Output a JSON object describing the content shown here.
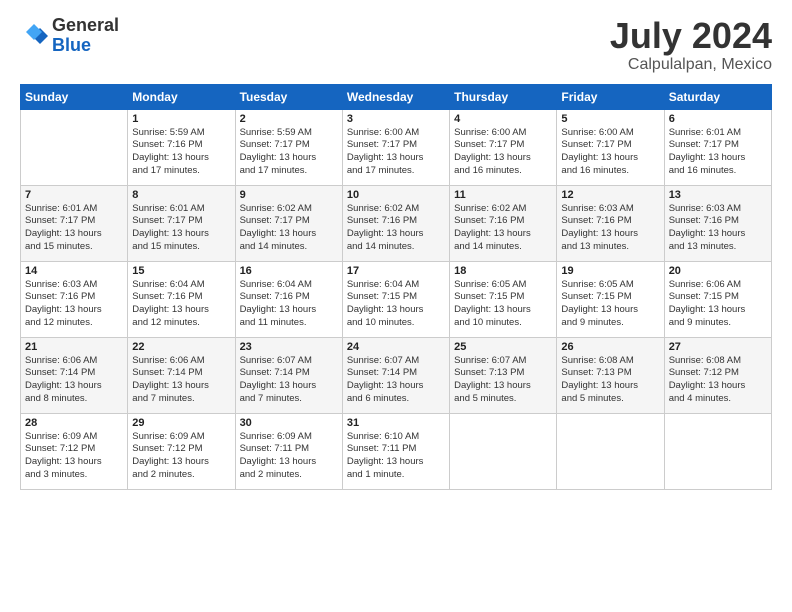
{
  "logo": {
    "general": "General",
    "blue": "Blue"
  },
  "title": "July 2024",
  "location": "Calpulalpan, Mexico",
  "days_of_week": [
    "Sunday",
    "Monday",
    "Tuesday",
    "Wednesday",
    "Thursday",
    "Friday",
    "Saturday"
  ],
  "weeks": [
    [
      {
        "day": "",
        "info": ""
      },
      {
        "day": "1",
        "info": "Sunrise: 5:59 AM\nSunset: 7:16 PM\nDaylight: 13 hours\nand 17 minutes."
      },
      {
        "day": "2",
        "info": "Sunrise: 5:59 AM\nSunset: 7:17 PM\nDaylight: 13 hours\nand 17 minutes."
      },
      {
        "day": "3",
        "info": "Sunrise: 6:00 AM\nSunset: 7:17 PM\nDaylight: 13 hours\nand 17 minutes."
      },
      {
        "day": "4",
        "info": "Sunrise: 6:00 AM\nSunset: 7:17 PM\nDaylight: 13 hours\nand 16 minutes."
      },
      {
        "day": "5",
        "info": "Sunrise: 6:00 AM\nSunset: 7:17 PM\nDaylight: 13 hours\nand 16 minutes."
      },
      {
        "day": "6",
        "info": "Sunrise: 6:01 AM\nSunset: 7:17 PM\nDaylight: 13 hours\nand 16 minutes."
      }
    ],
    [
      {
        "day": "7",
        "info": "Sunrise: 6:01 AM\nSunset: 7:17 PM\nDaylight: 13 hours\nand 15 minutes."
      },
      {
        "day": "8",
        "info": "Sunrise: 6:01 AM\nSunset: 7:17 PM\nDaylight: 13 hours\nand 15 minutes."
      },
      {
        "day": "9",
        "info": "Sunrise: 6:02 AM\nSunset: 7:17 PM\nDaylight: 13 hours\nand 14 minutes."
      },
      {
        "day": "10",
        "info": "Sunrise: 6:02 AM\nSunset: 7:16 PM\nDaylight: 13 hours\nand 14 minutes."
      },
      {
        "day": "11",
        "info": "Sunrise: 6:02 AM\nSunset: 7:16 PM\nDaylight: 13 hours\nand 14 minutes."
      },
      {
        "day": "12",
        "info": "Sunrise: 6:03 AM\nSunset: 7:16 PM\nDaylight: 13 hours\nand 13 minutes."
      },
      {
        "day": "13",
        "info": "Sunrise: 6:03 AM\nSunset: 7:16 PM\nDaylight: 13 hours\nand 13 minutes."
      }
    ],
    [
      {
        "day": "14",
        "info": "Sunrise: 6:03 AM\nSunset: 7:16 PM\nDaylight: 13 hours\nand 12 minutes."
      },
      {
        "day": "15",
        "info": "Sunrise: 6:04 AM\nSunset: 7:16 PM\nDaylight: 13 hours\nand 12 minutes."
      },
      {
        "day": "16",
        "info": "Sunrise: 6:04 AM\nSunset: 7:16 PM\nDaylight: 13 hours\nand 11 minutes."
      },
      {
        "day": "17",
        "info": "Sunrise: 6:04 AM\nSunset: 7:15 PM\nDaylight: 13 hours\nand 10 minutes."
      },
      {
        "day": "18",
        "info": "Sunrise: 6:05 AM\nSunset: 7:15 PM\nDaylight: 13 hours\nand 10 minutes."
      },
      {
        "day": "19",
        "info": "Sunrise: 6:05 AM\nSunset: 7:15 PM\nDaylight: 13 hours\nand 9 minutes."
      },
      {
        "day": "20",
        "info": "Sunrise: 6:06 AM\nSunset: 7:15 PM\nDaylight: 13 hours\nand 9 minutes."
      }
    ],
    [
      {
        "day": "21",
        "info": "Sunrise: 6:06 AM\nSunset: 7:14 PM\nDaylight: 13 hours\nand 8 minutes."
      },
      {
        "day": "22",
        "info": "Sunrise: 6:06 AM\nSunset: 7:14 PM\nDaylight: 13 hours\nand 7 minutes."
      },
      {
        "day": "23",
        "info": "Sunrise: 6:07 AM\nSunset: 7:14 PM\nDaylight: 13 hours\nand 7 minutes."
      },
      {
        "day": "24",
        "info": "Sunrise: 6:07 AM\nSunset: 7:14 PM\nDaylight: 13 hours\nand 6 minutes."
      },
      {
        "day": "25",
        "info": "Sunrise: 6:07 AM\nSunset: 7:13 PM\nDaylight: 13 hours\nand 5 minutes."
      },
      {
        "day": "26",
        "info": "Sunrise: 6:08 AM\nSunset: 7:13 PM\nDaylight: 13 hours\nand 5 minutes."
      },
      {
        "day": "27",
        "info": "Sunrise: 6:08 AM\nSunset: 7:12 PM\nDaylight: 13 hours\nand 4 minutes."
      }
    ],
    [
      {
        "day": "28",
        "info": "Sunrise: 6:09 AM\nSunset: 7:12 PM\nDaylight: 13 hours\nand 3 minutes."
      },
      {
        "day": "29",
        "info": "Sunrise: 6:09 AM\nSunset: 7:12 PM\nDaylight: 13 hours\nand 2 minutes."
      },
      {
        "day": "30",
        "info": "Sunrise: 6:09 AM\nSunset: 7:11 PM\nDaylight: 13 hours\nand 2 minutes."
      },
      {
        "day": "31",
        "info": "Sunrise: 6:10 AM\nSunset: 7:11 PM\nDaylight: 13 hours\nand 1 minute."
      },
      {
        "day": "",
        "info": ""
      },
      {
        "day": "",
        "info": ""
      },
      {
        "day": "",
        "info": ""
      }
    ]
  ]
}
